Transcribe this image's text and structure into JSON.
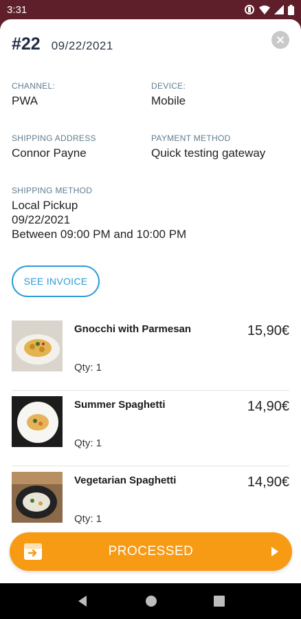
{
  "status_bar": {
    "time": "3:31"
  },
  "order": {
    "number": "#22",
    "date": "09/22/2021"
  },
  "fields": {
    "channel": {
      "label": "CHANNEL:",
      "value": "PWA"
    },
    "device": {
      "label": "DEVICE:",
      "value": "Mobile"
    },
    "shipping_address": {
      "label": "SHIPPING ADDRESS",
      "value": "Connor Payne"
    },
    "payment_method": {
      "label": "PAYMENT METHOD",
      "value": "Quick testing gateway"
    },
    "shipping_method": {
      "label": "SHIPPING METHOD",
      "line1": "Local Pickup",
      "line2": "09/22/2021",
      "line3": "Between 09:00 PM and 10:00 PM"
    }
  },
  "invoice_button": {
    "label": "SEE INVOICE"
  },
  "items": [
    {
      "name": "Gnocchi with Parmesan",
      "qty": "Qty: 1",
      "price": "15,90€"
    },
    {
      "name": "Summer Spaghetti",
      "qty": "Qty: 1",
      "price": "14,90€"
    },
    {
      "name": "Vegetarian Spaghetti",
      "qty": "Qty: 1",
      "price": "14,90€"
    }
  ],
  "status_button": {
    "label": "PROCESSED"
  },
  "colors": {
    "primary": "#f79a14",
    "link": "#2b9bd6",
    "status_bar": "#5e1f2a"
  }
}
